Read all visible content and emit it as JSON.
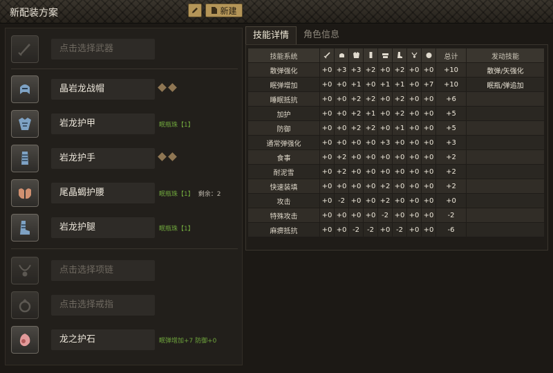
{
  "window": {
    "title": "新配装方案",
    "new_button_label": "新建",
    "edit_icon": "pencil-icon",
    "new_icon": "document-icon"
  },
  "equipment": {
    "weapon": {
      "label": "点击选择武器",
      "icon": "sword-icon"
    },
    "head": {
      "label": "晶岩龙战帽",
      "icon": "helmet-icon",
      "slots": 2
    },
    "chest": {
      "label": "岩龙护甲",
      "icon": "chest-armor-icon",
      "decoration": "眠瓶珠【1】"
    },
    "arms": {
      "label": "岩龙护手",
      "icon": "gauntlet-icon",
      "slots": 2
    },
    "waist": {
      "label": "尾晶蝎护腰",
      "icon": "waist-armor-icon",
      "decoration": "眠瓶珠【1】",
      "remaining": "剩余：2"
    },
    "legs": {
      "label": "岩龙护腿",
      "icon": "leg-armor-icon",
      "decoration": "眠瓶珠【1】"
    },
    "necklace": {
      "label": "点击选择项链",
      "icon": "necklace-icon"
    },
    "ring": {
      "label": "点击选择戒指",
      "icon": "ring-icon"
    },
    "talisman": {
      "label": "龙之护石",
      "icon": "talisman-icon",
      "skills": "眠弹增加+7  防御+0"
    }
  },
  "tabs": [
    {
      "label": "技能详情",
      "active": true
    },
    {
      "label": "角色信息",
      "active": false
    }
  ],
  "skill_table": {
    "headers": {
      "skill_system": "技能系统",
      "icons": [
        "weapon-icon",
        "helmet-icon",
        "chest-armor-icon",
        "gauntlet-icon",
        "waist-armor-icon",
        "leg-armor-icon",
        "necklace-icon",
        "talisman-icon"
      ],
      "total": "总计",
      "activated": "发动技能"
    },
    "rows": [
      {
        "name": "散弹强化",
        "values": [
          "+0",
          "+3",
          "+3",
          "+2",
          "+0",
          "+2",
          "+0",
          "+0"
        ],
        "total": "+10",
        "activated": "散弹/矢强化"
      },
      {
        "name": "眠弹增加",
        "values": [
          "+0",
          "+0",
          "+1",
          "+0",
          "+1",
          "+1",
          "+0",
          "+7"
        ],
        "total": "+10",
        "activated": "眠瓶/弹追加"
      },
      {
        "name": "睡眠抵抗",
        "values": [
          "+0",
          "+0",
          "+2",
          "+2",
          "+0",
          "+2",
          "+0",
          "+0"
        ],
        "total": "+6",
        "activated": ""
      },
      {
        "name": "加护",
        "values": [
          "+0",
          "+0",
          "+2",
          "+1",
          "+0",
          "+2",
          "+0",
          "+0"
        ],
        "total": "+5",
        "activated": ""
      },
      {
        "name": "防御",
        "values": [
          "+0",
          "+0",
          "+2",
          "+2",
          "+0",
          "+1",
          "+0",
          "+0"
        ],
        "total": "+5",
        "activated": ""
      },
      {
        "name": "通常弹强化",
        "values": [
          "+0",
          "+0",
          "+0",
          "+0",
          "+3",
          "+0",
          "+0",
          "+0"
        ],
        "total": "+3",
        "activated": ""
      },
      {
        "name": "食事",
        "values": [
          "+0",
          "+2",
          "+0",
          "+0",
          "+0",
          "+0",
          "+0",
          "+0"
        ],
        "total": "+2",
        "activated": ""
      },
      {
        "name": "耐泥雪",
        "values": [
          "+0",
          "+2",
          "+0",
          "+0",
          "+0",
          "+0",
          "+0",
          "+0"
        ],
        "total": "+2",
        "activated": ""
      },
      {
        "name": "快速装填",
        "values": [
          "+0",
          "+0",
          "+0",
          "+0",
          "+2",
          "+0",
          "+0",
          "+0"
        ],
        "total": "+2",
        "activated": ""
      },
      {
        "name": "攻击",
        "values": [
          "+0",
          "-2",
          "+0",
          "+0",
          "+2",
          "+0",
          "+0",
          "+0"
        ],
        "total": "+0",
        "activated": ""
      },
      {
        "name": "特殊攻击",
        "values": [
          "+0",
          "+0",
          "+0",
          "+0",
          "-2",
          "+0",
          "+0",
          "+0"
        ],
        "total": "-2",
        "activated": ""
      },
      {
        "name": "麻痹抵抗",
        "values": [
          "+0",
          "+0",
          "-2",
          "-2",
          "+0",
          "-2",
          "+0",
          "+0"
        ],
        "total": "-6",
        "activated": ""
      }
    ]
  },
  "colors": {
    "decoration_text": "#6fa53c",
    "button_gold": "#b49558",
    "slot_diamond": "#8f7653"
  }
}
